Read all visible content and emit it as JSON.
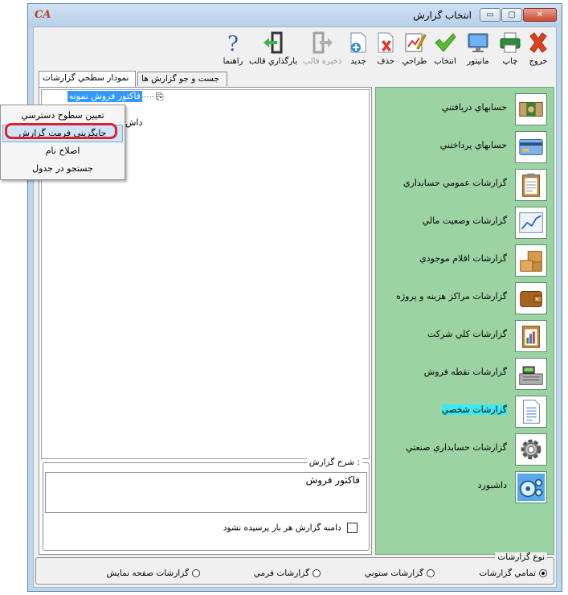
{
  "window": {
    "title": "انتخاب گزارش",
    "app_icon_text": "CA",
    "controls": {
      "minimize": "▭",
      "maximize": "▢",
      "close": "✕"
    }
  },
  "toolbar": {
    "exit": "خروج",
    "print": "چاپ",
    "monitor": "مانيتور",
    "select": "انتخاب",
    "design": "طراحي",
    "delete": "حذف",
    "new": "جديد",
    "save_template": "ذخيره قالب",
    "load_template": "بارگذاري قالب",
    "help": "راهنما"
  },
  "tabs": {
    "tree": "نمودار سطحي گزارشات",
    "search": "جست و جو گزارش ها"
  },
  "tree": {
    "selected_item": "فاكتور فروش نمونه",
    "partial_item": "داش"
  },
  "context_menu": {
    "items": [
      "تعيين سطوح دسترسي",
      "جايگزيني فرمت گزارش",
      "اصلاح نام",
      "جستجو در جدول"
    ]
  },
  "description": {
    "legend": "شرح گزارش :",
    "value": "فاكتور فروش",
    "checkbox_label": "دامنه گزارش هر بار پرسيده نشود"
  },
  "categories": [
    {
      "label": "حسابهاي دريافتني",
      "icon": "cash-icon"
    },
    {
      "label": "حسابهاي پرداختني",
      "icon": "credit-card-icon"
    },
    {
      "label": "گزارشات عمومي حسابداري",
      "icon": "clipboard-icon"
    },
    {
      "label": "گزارشات وضعيت مالي",
      "icon": "line-chart-icon"
    },
    {
      "label": "گزارشات اقلام موجودي",
      "icon": "boxes-icon"
    },
    {
      "label": "گزارشات مراكز هزينه و پروژه",
      "icon": "wallet-icon"
    },
    {
      "label": "گزارشات كلي شركت",
      "icon": "bar-chart-icon"
    },
    {
      "label": "گزارشات نقطه فروش",
      "icon": "cash-register-icon"
    },
    {
      "label": "گزارشات شخصي",
      "icon": "document-icon"
    },
    {
      "label": "گزارشات حسابداري صنعتي",
      "icon": "gear-icon"
    },
    {
      "label": "داشبورد",
      "icon": "dashboard-icon"
    }
  ],
  "report_types": {
    "legend": "نوع گزارشات",
    "options": [
      "تمامي گزارشات",
      "گزارشات ستوني",
      "گزارشات فرمي",
      "گزارشات صفحه نمايش"
    ],
    "selected": "تمامي گزارشات"
  },
  "colors": {
    "category_panel": "#9cd3a3",
    "highlight": "#3de8f0",
    "selection": "#3399ff",
    "annotation": "#e0202a"
  }
}
